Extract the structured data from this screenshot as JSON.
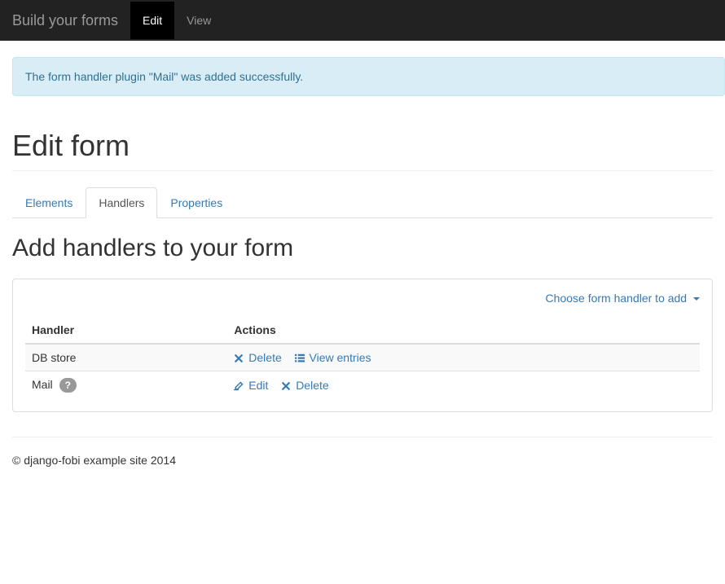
{
  "navbar": {
    "brand": "Build your forms",
    "items": [
      {
        "label": "Edit",
        "active": true
      },
      {
        "label": "View",
        "active": false
      }
    ]
  },
  "alert": {
    "message": "The form handler plugin \"Mail\" was added successfully."
  },
  "page": {
    "title": "Edit form"
  },
  "tabs": [
    {
      "label": "Elements",
      "active": false
    },
    {
      "label": "Handlers",
      "active": true
    },
    {
      "label": "Properties",
      "active": false
    }
  ],
  "section": {
    "title": "Add handlers to your form",
    "dropdown_label": "Choose form handler to add"
  },
  "table": {
    "headers": {
      "handler": "Handler",
      "actions": "Actions"
    },
    "rows": [
      {
        "name": "DB store",
        "help": false,
        "actions": [
          {
            "type": "delete",
            "label": "Delete"
          },
          {
            "type": "view_entries",
            "label": "View entries"
          }
        ]
      },
      {
        "name": "Mail",
        "help": true,
        "help_label": "?",
        "actions": [
          {
            "type": "edit",
            "label": "Edit"
          },
          {
            "type": "delete",
            "label": "Delete"
          }
        ]
      }
    ]
  },
  "footer": {
    "text": "© django-fobi example site 2014"
  }
}
